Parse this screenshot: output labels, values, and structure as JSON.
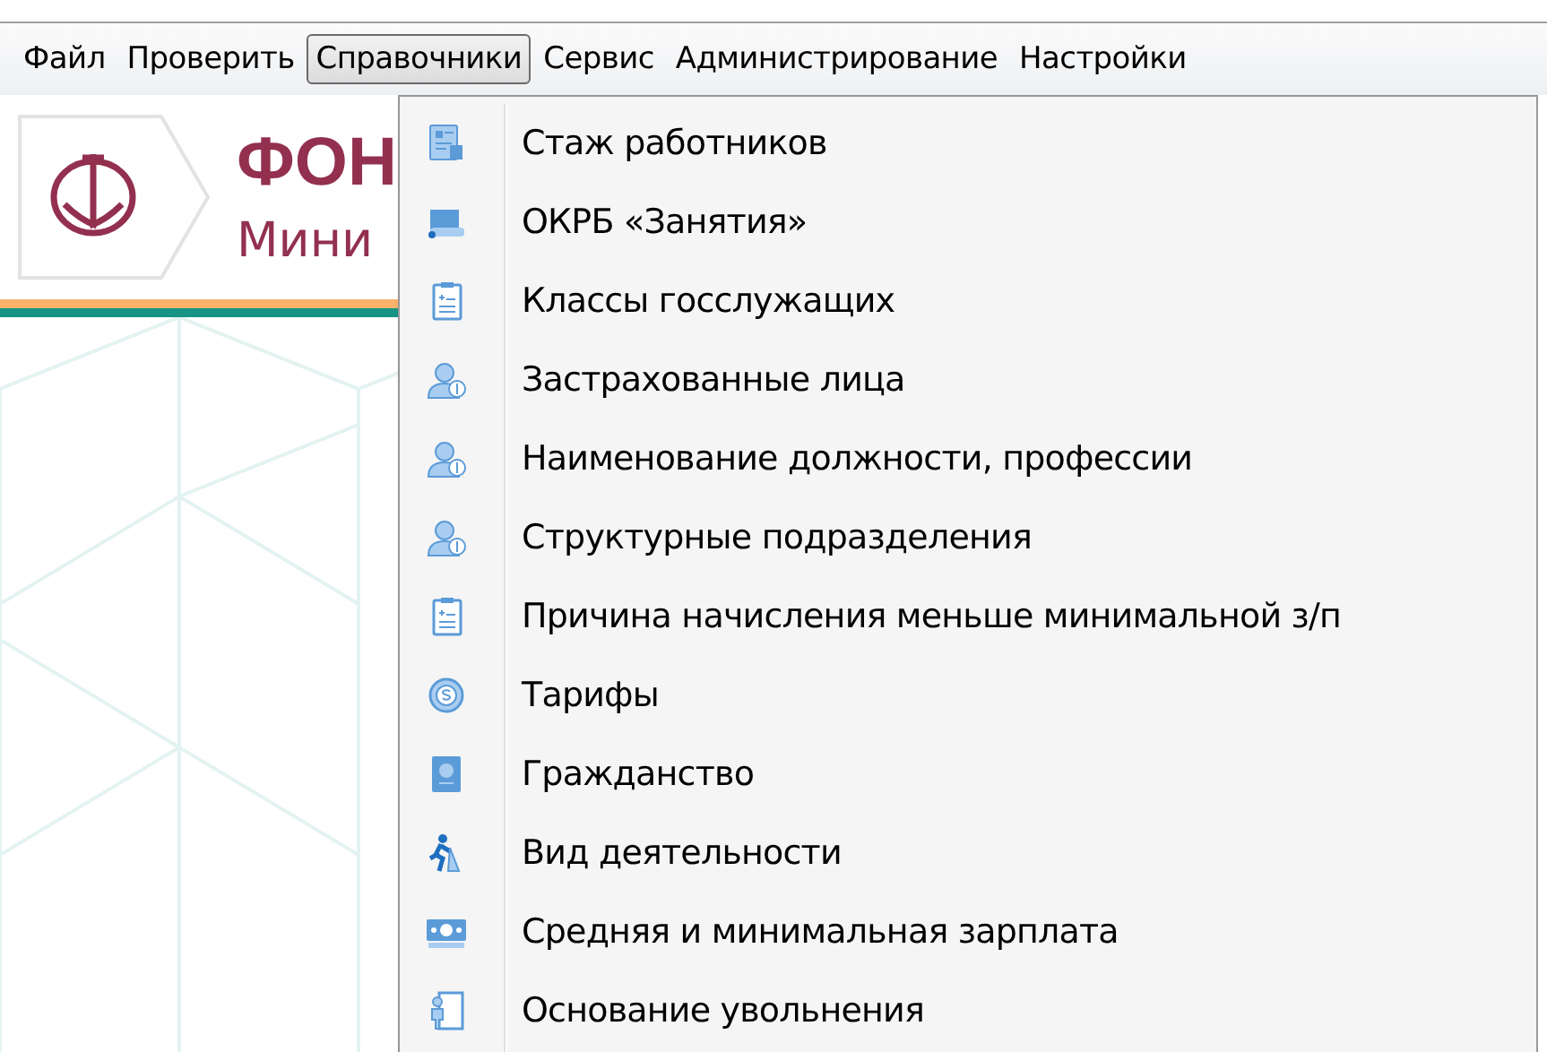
{
  "menu_bar": [
    {
      "label": "Файл",
      "selected": false
    },
    {
      "label": "Проверить",
      "selected": false
    },
    {
      "label": "Справочники",
      "selected": true
    },
    {
      "label": "Сервис",
      "selected": false
    },
    {
      "label": "Администрирование",
      "selected": false
    },
    {
      "label": "Настройки",
      "selected": false
    }
  ],
  "header": {
    "title": "ФОН",
    "subtitle": "Мини"
  },
  "dropdown": {
    "items": [
      {
        "label": "Стаж работников",
        "kind": "card"
      },
      {
        "label": "ОКРБ «Занятия»",
        "kind": "scroll"
      },
      {
        "label": "Классы госслужащих",
        "kind": "clipboard"
      },
      {
        "label": "Застрахованные лица",
        "kind": "person"
      },
      {
        "label": "Наименование должности, профессии",
        "kind": "person"
      },
      {
        "label": "Структурные подразделения",
        "kind": "person"
      },
      {
        "label": "Причина начисления меньше минимальной з/п",
        "kind": "clipboard"
      },
      {
        "label": "Тарифы",
        "kind": "coin"
      },
      {
        "label": "Гражданство",
        "kind": "passport"
      },
      {
        "label": "Вид деятельности",
        "kind": "runner"
      },
      {
        "label": "Средняя и минимальная зарплата",
        "kind": "money"
      },
      {
        "label": "Основание увольнения",
        "kind": "door"
      }
    ]
  }
}
